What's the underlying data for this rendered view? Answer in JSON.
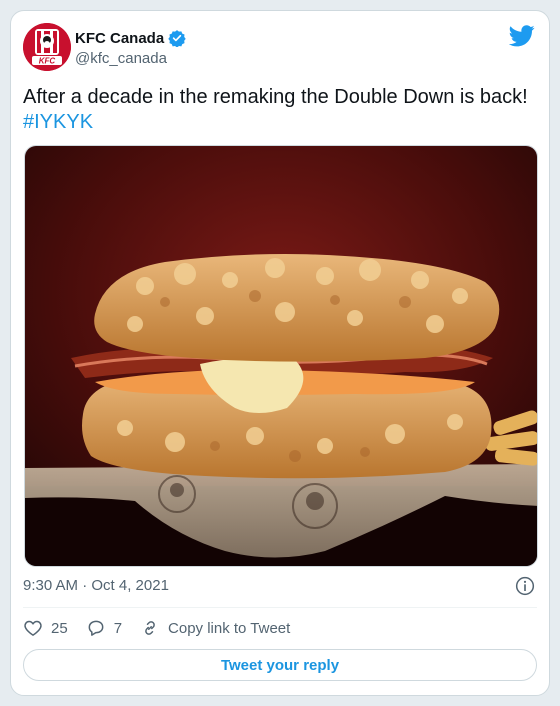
{
  "tweet": {
    "author": {
      "display_name": "KFC Canada",
      "handle": "@kfc_canada",
      "verified": true,
      "avatar_text": "KFC"
    },
    "text": "After a decade in the remaking the Double Down is back!",
    "hashtag": "#IYKYK",
    "timestamp": "9:30 AM · Oct 4, 2021",
    "likes": "25",
    "replies": "7",
    "copy_link_label": "Copy link to Tweet",
    "reply_button_label": "Tweet your reply"
  },
  "colors": {
    "accent": "#1b95e0",
    "brand_red": "#c8102e",
    "muted": "#536471"
  },
  "icons": [
    "twitter-bird-icon",
    "verified-badge-icon",
    "info-icon",
    "heart-icon",
    "reply-icon",
    "link-icon"
  ]
}
